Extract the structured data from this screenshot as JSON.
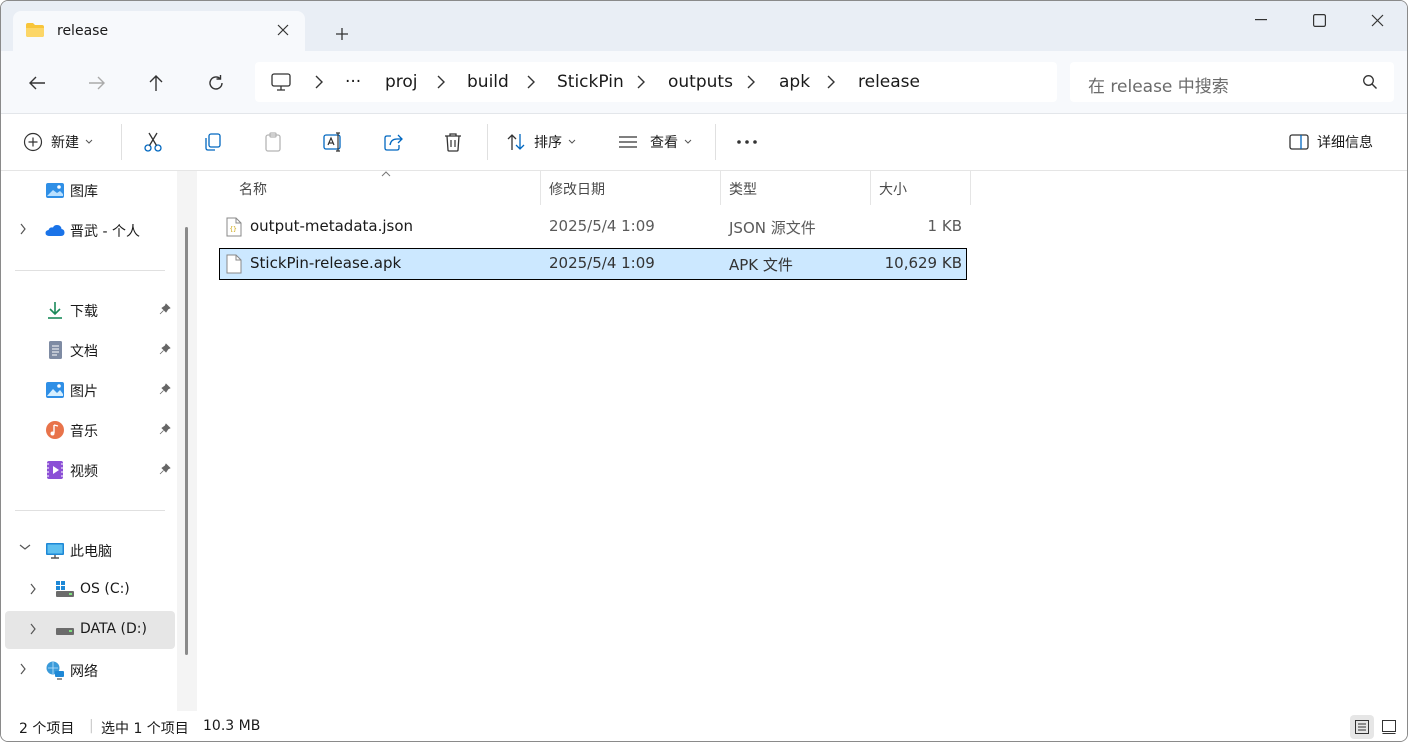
{
  "window": {
    "tab_title": "release",
    "colors": {
      "accent": "#0067c0",
      "selection": "#cce8ff",
      "folder": "#f8c53a"
    }
  },
  "nav": {
    "address_root_icon": "pc-icon",
    "overflow": "···",
    "crumbs": [
      "proj",
      "build",
      "StickPin",
      "outputs",
      "apk",
      "release"
    ],
    "search_placeholder": "在 release 中搜索"
  },
  "toolbar": {
    "new_label": "新建",
    "sort_label": "排序",
    "view_label": "查看",
    "more_label": "···",
    "details_label": "详细信息"
  },
  "sidebar": {
    "gallery": "图库",
    "onedrive": "晋武 - 个人",
    "quick": [
      "下载",
      "文档",
      "图片",
      "音乐",
      "视频"
    ],
    "thispc": "此电脑",
    "drives": [
      "OS (C:)",
      "DATA (D:)"
    ],
    "network": "网络"
  },
  "columns": {
    "name": "名称",
    "modified": "修改日期",
    "type": "类型",
    "size": "大小"
  },
  "files": [
    {
      "name": "output-metadata.json",
      "modified": "2025/5/4 1:09",
      "type": "JSON 源文件",
      "size": "1 KB",
      "selected": false
    },
    {
      "name": "StickPin-release.apk",
      "modified": "2025/5/4 1:09",
      "type": "APK 文件",
      "size": "10,629 KB",
      "selected": true
    }
  ],
  "status": {
    "count": "2 个项目",
    "selected": "选中 1 个项目",
    "selected_size": "10.3 MB"
  }
}
